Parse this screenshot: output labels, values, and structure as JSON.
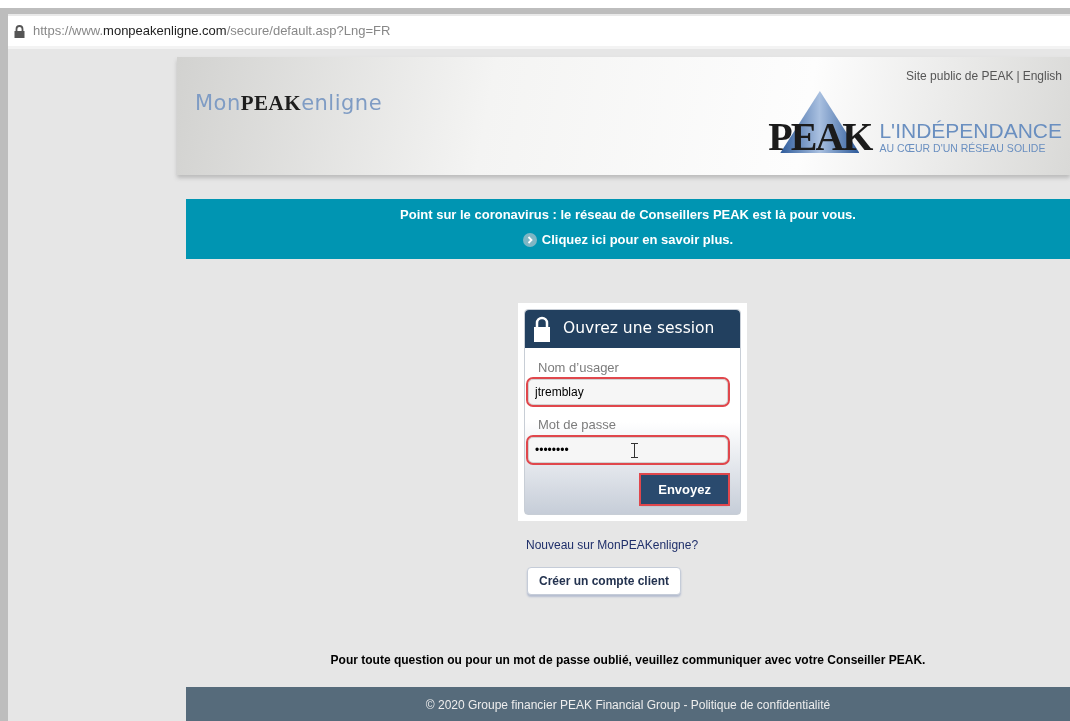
{
  "browser": {
    "url_host_prefix": "https://www.",
    "url_host": "monpeakenligne.com",
    "url_path": "/secure/default.asp?Lng=FR"
  },
  "header": {
    "logo": {
      "prefix": "Mon",
      "brand": "PEAK",
      "suffix": "enligne"
    },
    "links": [
      {
        "label": "Site public de PEAK"
      },
      {
        "label": "English"
      }
    ],
    "separator": "|",
    "wordmark": "PEAK",
    "tagline": "L'INDÉPENDANCE",
    "subtagline": "AU CŒUR D'UN RÉSEAU SOLIDE"
  },
  "banner": {
    "headline": "Point sur le coronavirus : le réseau de Conseillers PEAK est là pour vous.",
    "link": "Cliquez ici pour en savoir plus."
  },
  "login": {
    "title": "Ouvrez une session",
    "fields": [
      {
        "label": "Nom d’usager",
        "value": "jtremblay",
        "highlighted": true
      },
      {
        "label": "Mot de passe",
        "value": "••••••••",
        "highlighted": true
      }
    ],
    "submit": {
      "label": "Envoyez",
      "highlighted": true
    }
  },
  "new_user": {
    "prompt": "Nouveau sur MonPEAKenligne?",
    "button": "Créer un compte client"
  },
  "help_text": "Pour toute question ou pour un mot de passe oublié, veuillez communiquer avec votre Conseiller PEAK.",
  "footer": "© 2020 Groupe financier PEAK Financial Group - Politique de confidentialité"
}
